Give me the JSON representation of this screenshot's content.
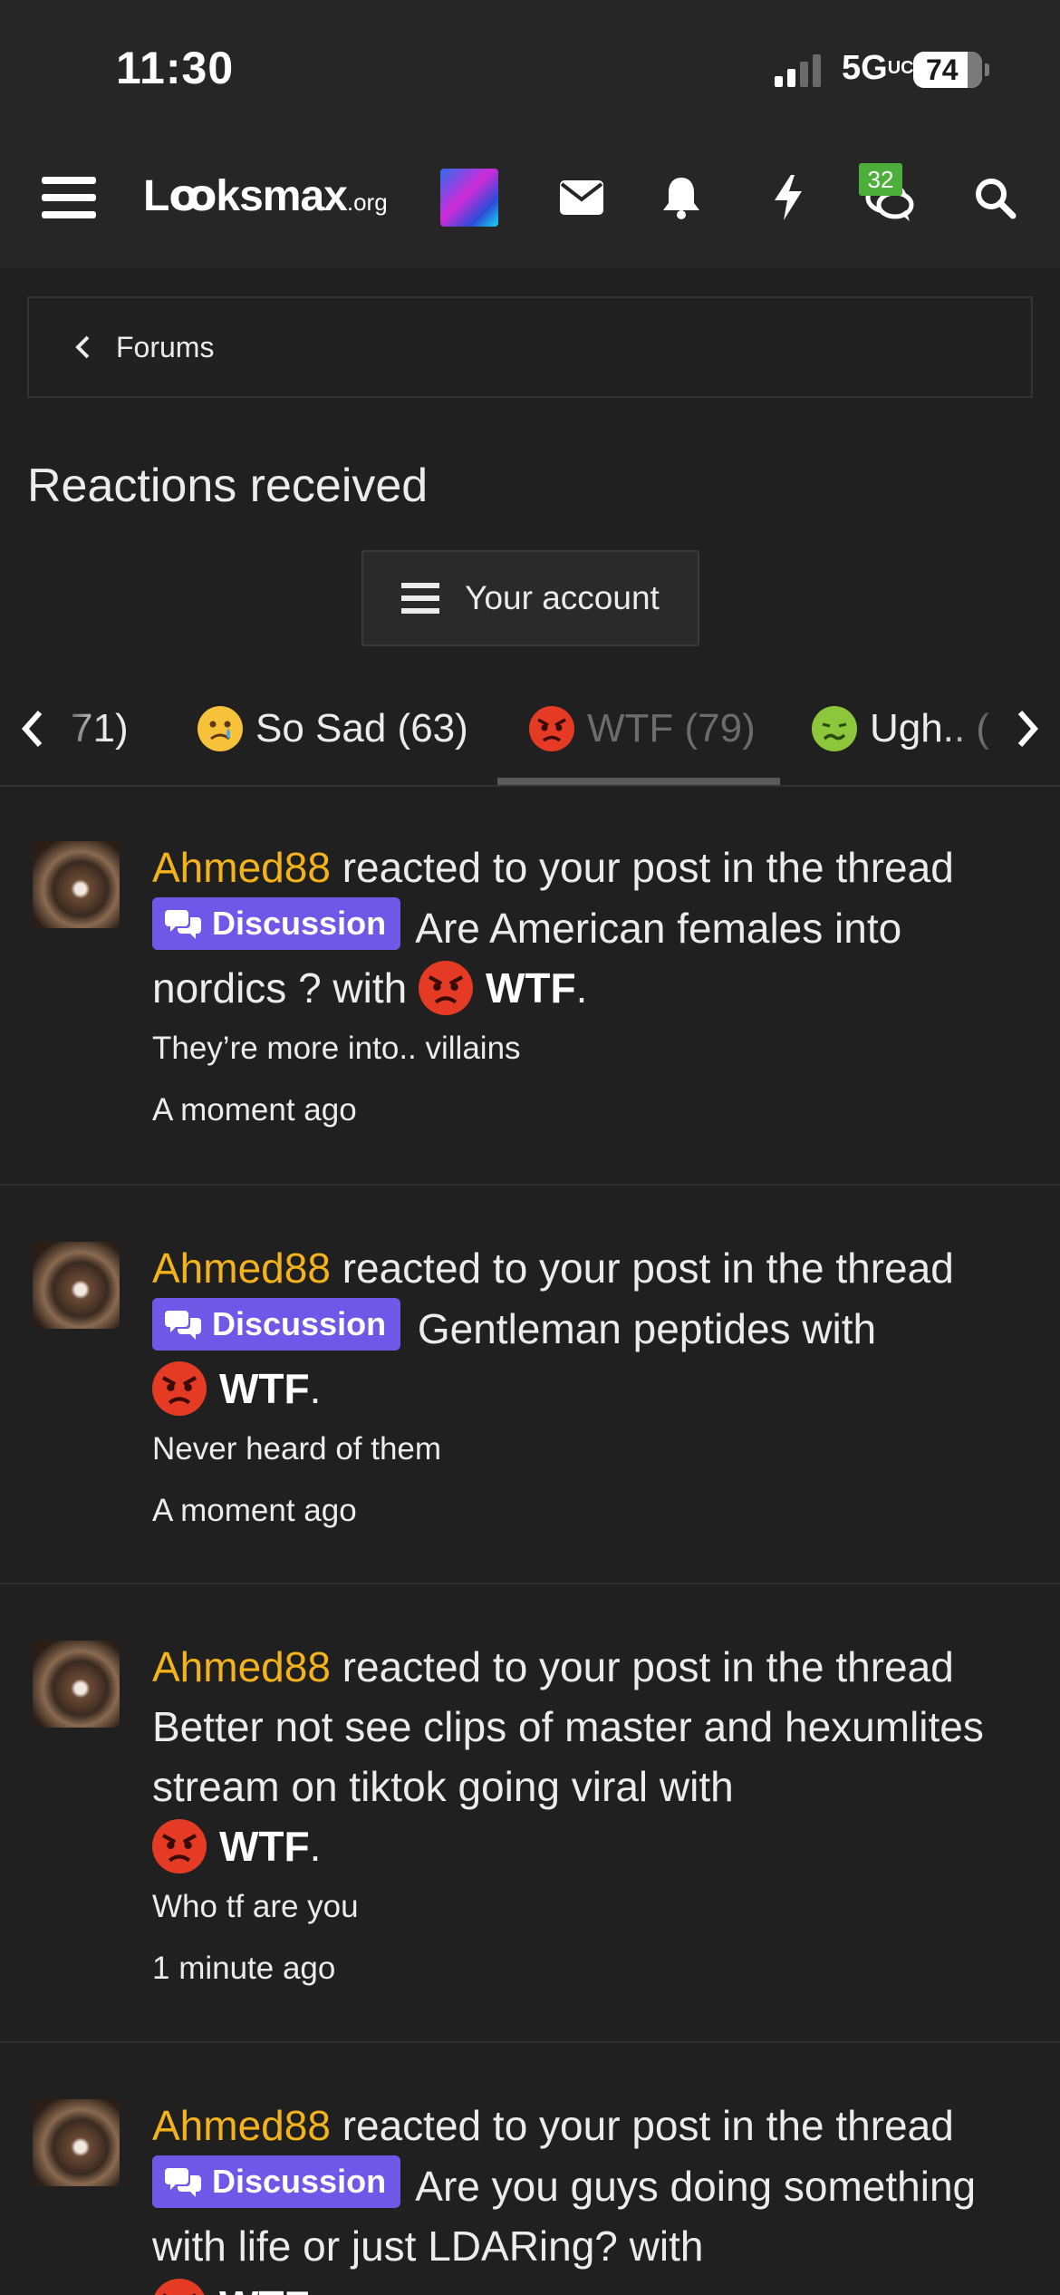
{
  "status_bar": {
    "time": "11:30",
    "network": "5G",
    "network_suffix": "UC",
    "battery": "74"
  },
  "navbar": {
    "logo": "Lꝏksmax",
    "logo_suffix": ".org",
    "chat_badge": "32"
  },
  "breadcrumb": {
    "label": "Forums"
  },
  "page_title": "Reactions received",
  "account_button": "Your account",
  "tabs": [
    {
      "label": "71)"
    },
    {
      "label": "So Sad (63)"
    },
    {
      "label": "WTF (79)",
      "active": true
    },
    {
      "label": "Ugh.. ("
    }
  ],
  "feed": [
    {
      "user": "Ahmed88",
      "action": " reacted to your post in the thread",
      "prefix": "Discussion",
      "thread": " Are American females into nordics ? with",
      "reaction": "WTF",
      "snippet": "They’re more into.. villains",
      "time": "A moment ago"
    },
    {
      "user": "Ahmed88",
      "action": " reacted to your post in the thread",
      "prefix": "Discussion",
      "thread": " Gentleman peptides with",
      "reaction": "WTF",
      "snippet": "Never heard of them",
      "time": "A moment ago"
    },
    {
      "user": "Ahmed88",
      "action": " reacted to your post in the thread",
      "prefix": "",
      "thread": "Better not see clips of master and hexumlites stream on tiktok going viral with",
      "reaction": "WTF",
      "snippet": "Who tf are you",
      "time": "1 minute ago"
    },
    {
      "user": "Ahmed88",
      "action": " reacted to your post in the thread",
      "prefix": "Discussion",
      "thread": " Are you guys doing something with life or just LDARing? with",
      "reaction": "WTF",
      "snippet": "",
      "time": ""
    }
  ],
  "colors": {
    "background": "#202020",
    "username": "#f4b31a",
    "prefix": "#6f57e8",
    "badge": "#4caf3a"
  }
}
